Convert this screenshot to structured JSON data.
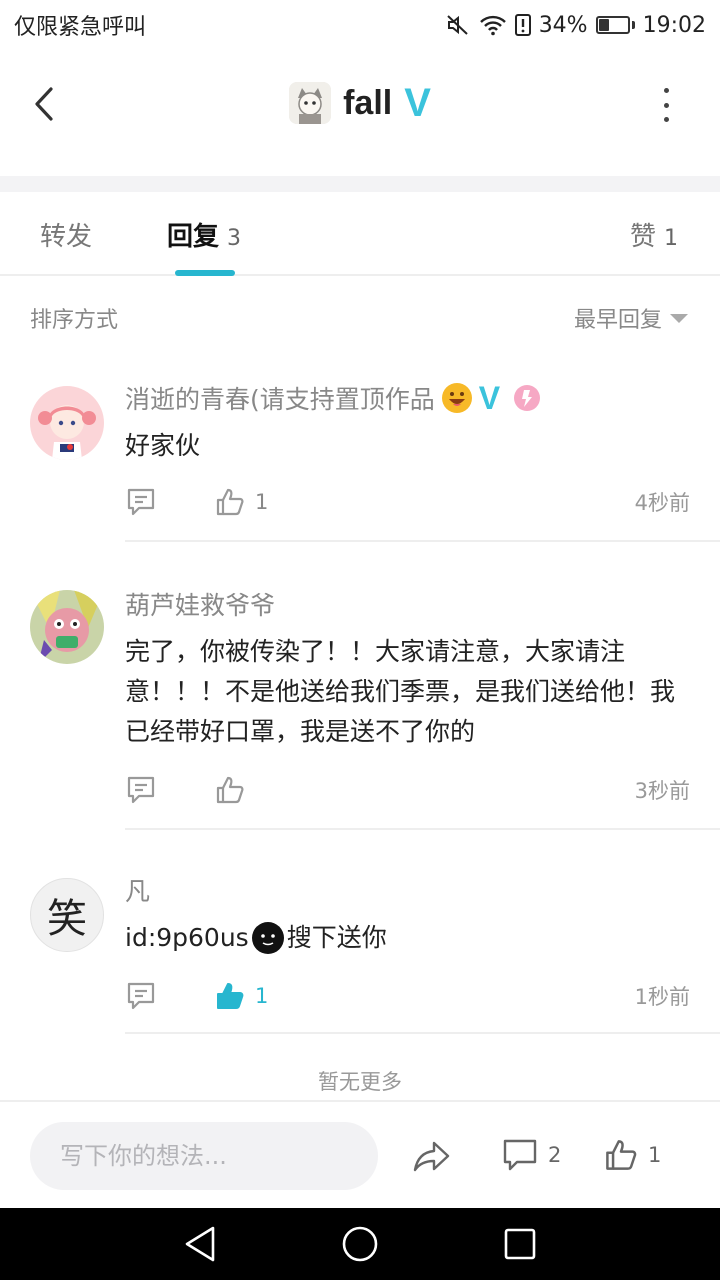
{
  "status_bar": {
    "left_text": "仅限紧急呼叫",
    "battery_percent": "34%",
    "battery_level": 0.34,
    "time": "19:02",
    "icons": [
      "mute-icon",
      "wifi-icon",
      "sim-alert-icon",
      "battery-icon"
    ]
  },
  "header": {
    "title": "fall",
    "verified_badge": "V",
    "icons": [
      "back-arrow-icon",
      "title-avatar",
      "more-vertical-icon"
    ]
  },
  "tabs": [
    {
      "label": "转发",
      "count": ""
    },
    {
      "label": "回复",
      "count": "3",
      "active": true
    },
    {
      "label": "赞",
      "count": "1"
    }
  ],
  "sort": {
    "label": "排序方式",
    "selected": "最早回复"
  },
  "comments": [
    {
      "name": "消逝的青春(请支持置顶作品",
      "text": "好家伙",
      "likes": "1",
      "liked": false,
      "time": "4秒前",
      "verified_badge": "V",
      "name_icons": [
        "smile-emoji-icon",
        "verified-v-icon",
        "pink-badge-icon"
      ]
    },
    {
      "name": "葫芦娃救爷爷",
      "text": "完了，你被传染了！！大家请注意，大家请注意！！！不是他送给我们季票，是我们送给他！我已经带好口罩，我是送不了你的",
      "likes": "",
      "liked": false,
      "time": "3秒前"
    },
    {
      "name": "凡",
      "text_prefix": "id:9p60us",
      "text_suffix": "搜下送你",
      "likes": "1",
      "liked": true,
      "time": "1秒前",
      "avatar_char": "笑"
    }
  ],
  "no_more": "暂无更多",
  "bottom_bar": {
    "placeholder": "写下你的想法...",
    "comments_count": "2",
    "likes_count": "1",
    "icons": [
      "share-arrow-icon",
      "comment-bubble-icon",
      "thumbs-up-icon"
    ]
  },
  "colors": {
    "accent": "#27b6cf",
    "verified": "#3bc3dc",
    "muted_text": "#888888",
    "divider": "#eeeeee"
  }
}
